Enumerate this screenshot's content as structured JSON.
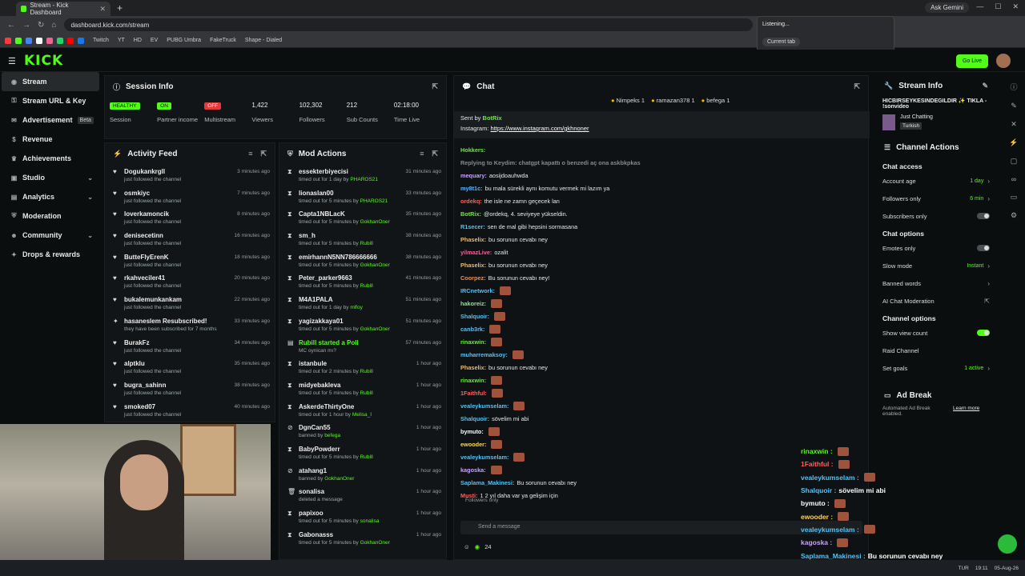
{
  "browser": {
    "tab_title": "Stream - Kick Dashboard",
    "url": "dashboard.kick.com/stream",
    "ask_gemini": "Ask Gemini",
    "bookmarks": [
      "Twitch",
      "YT",
      "HD",
      "EV",
      "PUBG Umbra",
      "FakeTruck",
      "Shape - Dialed"
    ]
  },
  "popup": {
    "listening": "Listening...",
    "current_tab": "Current tab"
  },
  "brand": {
    "logo": "KICK",
    "go_live": "Go Live",
    "accent": "#53fc18"
  },
  "sidebar": {
    "items": [
      {
        "label": "Stream",
        "icon": "circle-play-icon"
      },
      {
        "label": "Stream URL & Key",
        "icon": "key-icon"
      },
      {
        "label": "Advertisement",
        "badge": "Beta",
        "icon": "megaphone-icon"
      },
      {
        "label": "Revenue",
        "icon": "dollar-icon"
      },
      {
        "label": "Achievements",
        "icon": "trophy-icon"
      },
      {
        "label": "Studio",
        "icon": "studio-icon"
      },
      {
        "label": "Analytics",
        "icon": "chart-icon"
      },
      {
        "label": "Moderation",
        "icon": "shield-icon"
      },
      {
        "label": "Community",
        "icon": "users-icon"
      },
      {
        "label": "Drops & rewards",
        "icon": "gift-icon"
      }
    ]
  },
  "session": {
    "title": "Session Info",
    "stats": [
      {
        "value": "HEALTHY",
        "label": "Session",
        "pill": true,
        "color": "#53fc18"
      },
      {
        "value": "ON",
        "label": "Partner income",
        "pill": true,
        "color": "#53fc18"
      },
      {
        "value": "OFF",
        "label": "Multistream",
        "pill": true,
        "color": "#e23a3a"
      },
      {
        "value": "1,422",
        "label": "Viewers"
      },
      {
        "value": "102,302",
        "label": "Followers"
      },
      {
        "value": "212",
        "label": "Sub Counts"
      },
      {
        "value": "02:18:00",
        "label": "Time Live"
      }
    ]
  },
  "activity": {
    "title": "Activity Feed",
    "items": [
      {
        "name": "Dogukankrgll",
        "sub": "just followed the channel",
        "time": "3 minutes ago"
      },
      {
        "name": "osmkiyc",
        "sub": "just followed the channel",
        "time": "7 minutes ago"
      },
      {
        "name": "loverkamoncik",
        "sub": "just followed the channel",
        "time": "8 minutes ago"
      },
      {
        "name": "denisecetinn",
        "sub": "just followed the channel",
        "time": "16 minutes ago"
      },
      {
        "name": "ButteFlyErenK",
        "sub": "just followed the channel",
        "time": "18 minutes ago"
      },
      {
        "name": "rkahveciler41",
        "sub": "just followed the channel",
        "time": "20 minutes ago"
      },
      {
        "name": "bukalemunkankam",
        "sub": "just followed the channel",
        "time": "22 minutes ago"
      },
      {
        "name": "hasaneslem Resubscribed!",
        "sub": "they have been subscribed for 7 months",
        "time": "33 minutes ago"
      },
      {
        "name": "BurakFz",
        "sub": "just followed the channel",
        "time": "34 minutes ago"
      },
      {
        "name": "alptklu",
        "sub": "just followed the channel",
        "time": "35 minutes ago"
      },
      {
        "name": "bugra_sahinn",
        "sub": "just followed the channel",
        "time": "38 minutes ago"
      },
      {
        "name": "smoked07",
        "sub": "just followed the channel",
        "time": "40 minutes ago"
      }
    ]
  },
  "mod": {
    "title": "Mod Actions",
    "items": [
      {
        "name": "essekterbiyecisi",
        "sub": "timed out for 1 day by",
        "by": "PHAROS21",
        "time": "31 minutes ago"
      },
      {
        "name": "lionaslan00",
        "sub": "timed out for 5 minutes by",
        "by": "PHAROS21",
        "time": "33 minutes ago"
      },
      {
        "name": "Capta1NBLacK",
        "sub": "timed out for 5 minutes by",
        "by": "GokhanOner",
        "time": "35 minutes ago"
      },
      {
        "name": "sm_h",
        "sub": "timed out for 5 minutes by",
        "by": "Rubill",
        "time": "38 minutes ago"
      },
      {
        "name": "emirhannN5NN786666666",
        "sub": "timed out for 5 minutes by",
        "by": "GokhanOner",
        "time": "38 minutes ago"
      },
      {
        "name": "Peter_parker9663",
        "sub": "timed out for 5 minutes by",
        "by": "Rubill",
        "time": "41 minutes ago"
      },
      {
        "name": "M4A1PALA",
        "sub": "timed out for 1 day by",
        "by": "mlfoy",
        "time": "51 minutes ago"
      },
      {
        "name": "yagizakkaya01",
        "sub": "timed out for 5 minutes by",
        "by": "GokhanOner",
        "time": "51 minutes ago"
      },
      {
        "name": "Rubill started a Poll",
        "sub": "MC oynican mı?",
        "by": "",
        "time": "57 minutes ago"
      },
      {
        "name": "istanbule",
        "sub": "timed out for 2 minutes by",
        "by": "Rubill",
        "time": "1 hour ago"
      },
      {
        "name": "midyebakleva",
        "sub": "timed out for 5 minutes by",
        "by": "Rubill",
        "time": "1 hour ago"
      },
      {
        "name": "AskerdeThirtyOne",
        "sub": "timed out for 1 hour by",
        "by": "Melisa_I",
        "time": "1 hour ago"
      },
      {
        "name": "DgnCan55",
        "sub": "banned by",
        "by": "befega",
        "time": "1 hour ago"
      },
      {
        "name": "BabyPowderr",
        "sub": "timed out for 5 minutes by",
        "by": "Rubill",
        "time": "1 hour ago"
      },
      {
        "name": "atahang1",
        "sub": "banned by",
        "by": "GokhanOner",
        "time": "1 hour ago"
      },
      {
        "name": "sonalisa",
        "sub": "deleted a message",
        "by": "",
        "time": "1 hour ago"
      },
      {
        "name": "papixoo",
        "sub": "timed out for 5 minutes by",
        "by": "sonalisa",
        "time": "1 hour ago"
      },
      {
        "name": "Gabonasss",
        "sub": "timed out for 5 minutes by",
        "by": "GokhanOner",
        "time": "1 hour ago"
      }
    ]
  },
  "chat": {
    "title": "Chat",
    "gifters": [
      "Nimpeks 1",
      "ramazan378 1",
      "befega 1"
    ],
    "pinned_sent": "Sent by",
    "pinned_by": "BotRix",
    "pinned_text": "Instagram:",
    "pinned_link": "https://www.instagram.com/gkhnoner",
    "messages": [
      {
        "user": "Hokkers:",
        "color": "#53fc18",
        "text": ""
      },
      {
        "user": "Replying to Keydim: chatgpt kapattı o benzedi aç ona askbkpkas",
        "color": "#888",
        "text": ""
      },
      {
        "user": "mequary:",
        "color": "#c9a0ff",
        "text": "aosijdoauhwda"
      },
      {
        "user": "my8t1c:",
        "color": "#5ab4ff",
        "text": "bu mala sürekli aynı komutu vermek mi lazım ya"
      },
      {
        "user": "ordekq:",
        "color": "#ff5e5e",
        "text": "the isle ne zamn geçecek lan"
      },
      {
        "user": "BotRix:",
        "color": "#53fc18",
        "text": "@ordekq, 4. seviyeye yükseldin."
      },
      {
        "user": "R1secer:",
        "color": "#4fc3f7",
        "text": "sen de mal gibi hepsini sormasana"
      },
      {
        "user": "Phaselix:",
        "color": "#ffb74d",
        "text": "bu sorunun cevabı ney"
      },
      {
        "user": "yilmazLive:",
        "color": "#f06292",
        "text": "ozalit"
      },
      {
        "user": "Phaselix:",
        "color": "#ffb74d",
        "text": "bu sorunun cevabı ney"
      },
      {
        "user": "Coorpez:",
        "color": "#ff8a3d",
        "text": "Bu sorunun cevabı ney!"
      },
      {
        "user": "IRCnetwork:",
        "color": "#4fc3f7",
        "text": ""
      },
      {
        "user": "hakoreiz:",
        "color": "#a5d6a7",
        "text": ""
      },
      {
        "user": "Shalquoir:",
        "color": "#4fc3f7",
        "text": ""
      },
      {
        "user": "canb3rk:",
        "color": "#4fc3f7",
        "text": ""
      },
      {
        "user": "rinaxwin:",
        "color": "#53fc18",
        "text": ""
      },
      {
        "user": "muharremaksoy:",
        "color": "#4fc3f7",
        "text": ""
      },
      {
        "user": "Phaselix:",
        "color": "#ffb74d",
        "text": "bu sorunun cevabı ney"
      },
      {
        "user": "rinaxwin:",
        "color": "#53fc18",
        "text": ""
      },
      {
        "user": "1Faithful:",
        "color": "#ff5e5e",
        "text": ""
      },
      {
        "user": "vealeykumselam:",
        "color": "#4fc3f7",
        "text": ""
      },
      {
        "user": "Shalquoir:",
        "color": "#4fc3f7",
        "text": "sövelim mi abi"
      },
      {
        "user": "bymuto:",
        "color": "#fff",
        "text": ""
      },
      {
        "user": "ewooder:",
        "color": "#ffd54f",
        "text": ""
      },
      {
        "user": "vealeykumselam:",
        "color": "#4fc3f7",
        "text": ""
      },
      {
        "user": "kagoska:",
        "color": "#c9a0ff",
        "text": ""
      },
      {
        "user": "Saplama_Makinesi:",
        "color": "#4fc3f7",
        "text": "Bu sorunun cevabı ney"
      },
      {
        "user": "Musti:",
        "color": "#ff5e5e",
        "text": "1 2 yıl daha var ya gelişim için"
      }
    ],
    "followers_only": "Followers only",
    "input_placeholder": "Send a message",
    "count": "24"
  },
  "overlay": [
    {
      "user": "rinaxwin :",
      "color": "#53fc18",
      "text": ""
    },
    {
      "user": "1Faithful :",
      "color": "#ff5e5e",
      "text": ""
    },
    {
      "user": "vealeykumselam :",
      "color": "#4fc3f7",
      "text": ""
    },
    {
      "user": "Shalquoir :",
      "color": "#4fc3f7",
      "text": "sövelim mi abi"
    },
    {
      "user": "bymuto :",
      "color": "#fff",
      "text": ""
    },
    {
      "user": "ewooder :",
      "color": "#ffd54f",
      "text": ""
    },
    {
      "user": "vealeykumselam :",
      "color": "#4fc3f7",
      "text": ""
    },
    {
      "user": "kagoska :",
      "color": "#c9a0ff",
      "text": ""
    },
    {
      "user": "Saplama_Makinesi :",
      "color": "#4fc3f7",
      "text": "Bu sorunun cevabı ney"
    }
  ],
  "stream_info": {
    "title": "Stream Info",
    "stream_title": "HICBIRSEYKESINDEGILDIR ✨ TIKLA - !sonvideo",
    "category": "Just Chatting",
    "language": "Turkish"
  },
  "channel_actions": {
    "title": "Channel Actions",
    "chat_access": "Chat access",
    "account_age": "Account age",
    "account_age_val": "1 day",
    "followers_only": "Followers only",
    "followers_only_val": "6 min",
    "subscribers_only": "Subscribers only",
    "chat_options": "Chat options",
    "emotes_only": "Emotes only",
    "slow_mode": "Slow mode",
    "slow_mode_val": "Instant",
    "banned_words": "Banned words",
    "ai_moderation": "AI Chat Moderation",
    "channel_options": "Channel options",
    "show_view_count": "Show view count",
    "raid_channel": "Raid Channel",
    "set_goals": "Set goals",
    "set_goals_val": "1 active"
  },
  "ad_break": {
    "title": "Ad Break",
    "text": "Automated Ad Break enabled.",
    "learn_more": "Learn more"
  },
  "taskbar": {
    "lang": "TUR",
    "time": "19:11",
    "date": "05-Aug-26"
  }
}
